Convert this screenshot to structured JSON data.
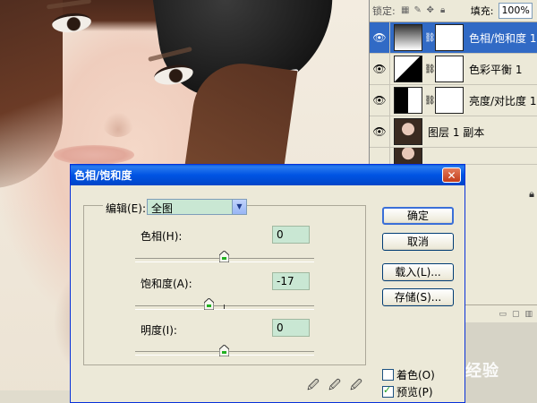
{
  "layers_panel": {
    "lock_label": "锁定:",
    "fill_label": "填充:",
    "fill_value": "100%",
    "layers": [
      {
        "name": "色相/饱和度 1",
        "selected": true,
        "thumb": "gradient-icon"
      },
      {
        "name": "色彩平衡 1",
        "selected": false,
        "thumb": "balance-icon"
      },
      {
        "name": "亮度/对比度 1",
        "selected": false,
        "thumb": "brightness-icon"
      },
      {
        "name": "图层 1 副本",
        "selected": false,
        "thumb": "photo-thumbnail"
      }
    ]
  },
  "dialog": {
    "title": "色相/饱和度",
    "edit_label": "编辑(E):",
    "edit_value": "全图",
    "hue": {
      "label": "色相(H):",
      "value": "0",
      "position": 0.5
    },
    "saturation": {
      "label": "饱和度(A):",
      "value": "-17",
      "position": 0.415
    },
    "lightness": {
      "label": "明度(I):",
      "value": "0",
      "position": 0.5
    },
    "buttons": {
      "ok": "确定",
      "cancel": "取消",
      "load": "载入(L)...",
      "save": "存储(S)..."
    },
    "colorize": {
      "label": "着色(O)",
      "checked": false
    },
    "preview": {
      "label": "预览(P)",
      "checked": true
    }
  },
  "watermark": {
    "text": "经验"
  },
  "colors": {
    "title_bar": "#0054e3",
    "dialog_bg": "#ece9d8",
    "field_bg": "#c9e7d3"
  }
}
